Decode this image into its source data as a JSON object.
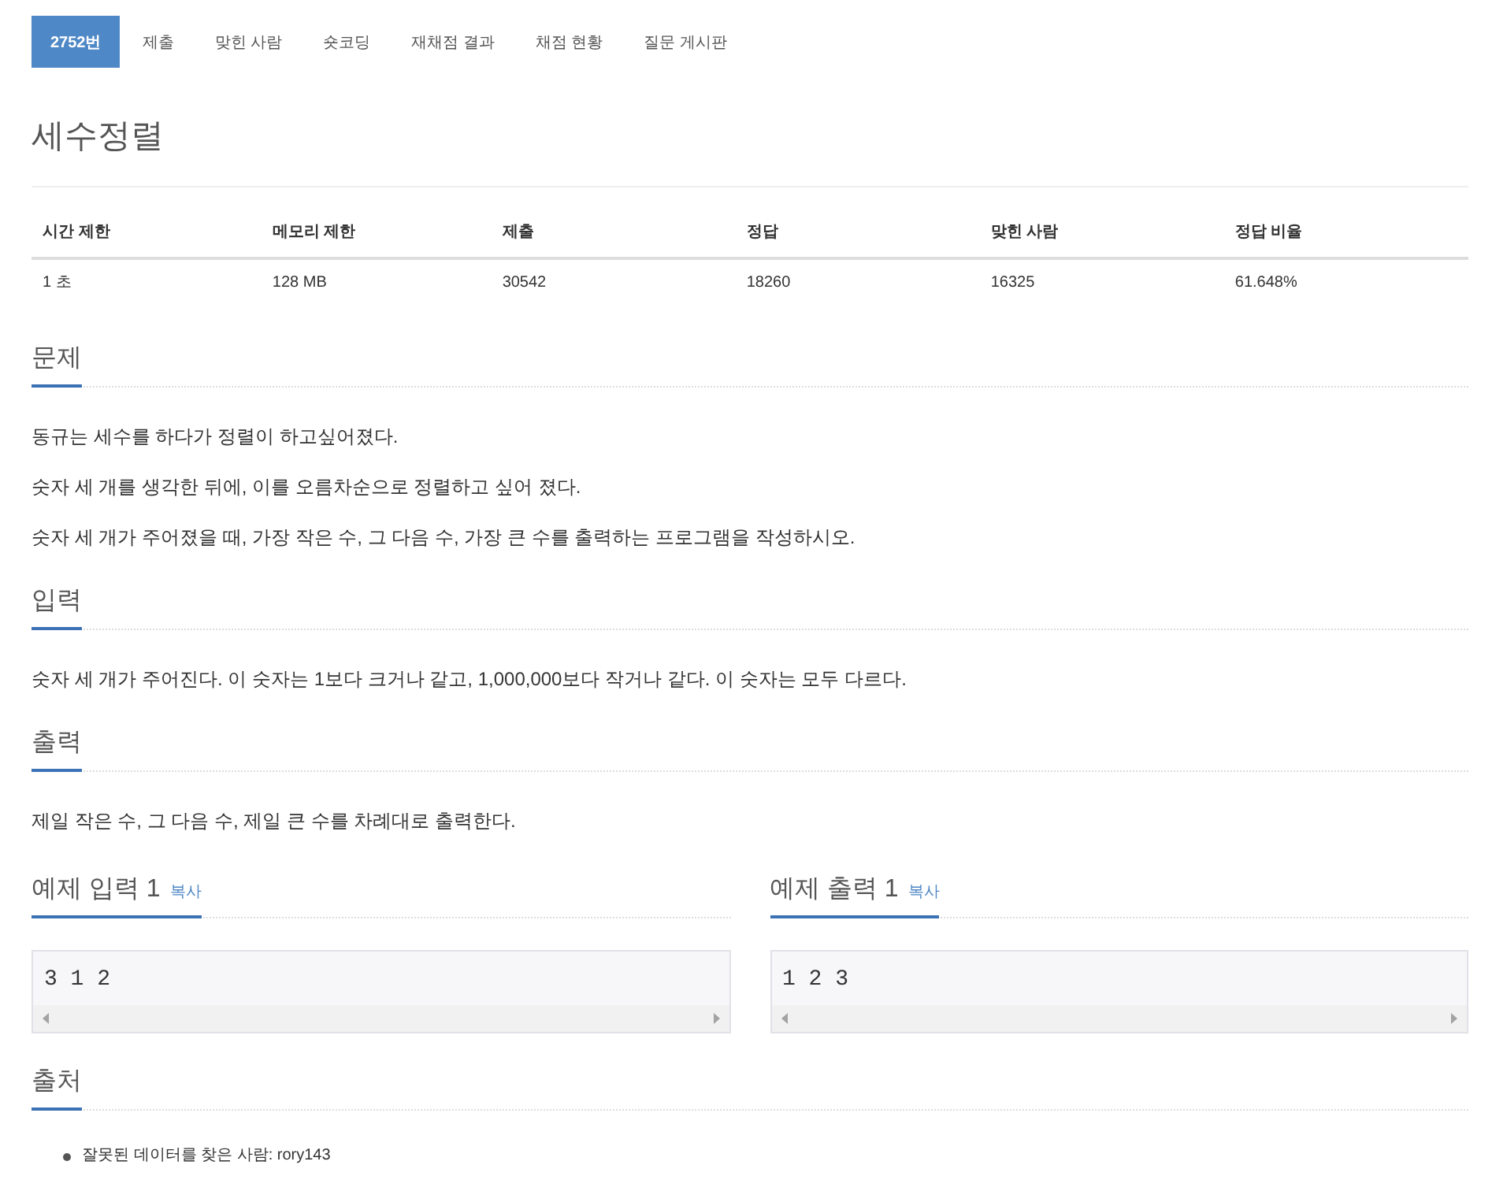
{
  "tabs": [
    {
      "label": "2752번",
      "selected": true
    },
    {
      "label": "제출",
      "selected": false
    },
    {
      "label": "맞힌 사람",
      "selected": false
    },
    {
      "label": "숏코딩",
      "selected": false
    },
    {
      "label": "재채점 결과",
      "selected": false
    },
    {
      "label": "채점 현황",
      "selected": false
    },
    {
      "label": "질문 게시판",
      "selected": false
    }
  ],
  "title": "세수정렬",
  "info_table": {
    "columns": [
      "시간 제한",
      "메모리 제한",
      "제출",
      "정답",
      "맞힌 사람",
      "정답 비율"
    ],
    "rows": [
      [
        "1 초",
        "128 MB",
        "30542",
        "18260",
        "16325",
        "61.648%"
      ]
    ]
  },
  "sections": [
    {
      "heading": "문제",
      "paragraphs": [
        "동규는 세수를 하다가 정렬이 하고싶어졌다.",
        "숫자 세 개를 생각한 뒤에, 이를 오름차순으로 정렬하고 싶어 졌다.",
        "숫자 세 개가 주어졌을 때, 가장 작은 수, 그 다음 수, 가장 큰 수를 출력하는 프로그램을 작성하시오."
      ]
    },
    {
      "heading": "입력",
      "paragraphs": [
        "숫자 세 개가 주어진다. 이 숫자는 1보다 크거나 같고, 1,000,000보다 작거나 같다. 이 숫자는 모두 다르다."
      ]
    },
    {
      "heading": "출력",
      "paragraphs": [
        "제일 작은 수, 그 다음 수, 제일 큰 수를 차례대로 출력한다."
      ]
    }
  ],
  "samples": [
    {
      "heading": "예제 입력 1",
      "copy_link": "복사",
      "content": "3 1 2"
    },
    {
      "heading": "예제 출력 1",
      "copy_link": "복사",
      "content": "1 2 3"
    }
  ],
  "source": {
    "heading": "출처",
    "items": [
      "잘못된 데이터를 찾은 사람: rory143"
    ]
  }
}
